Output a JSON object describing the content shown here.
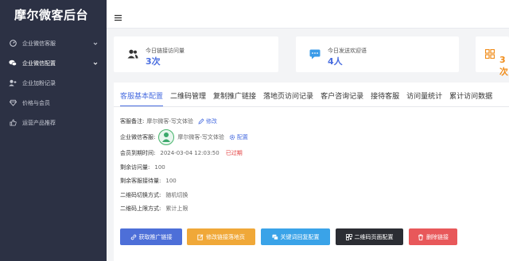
{
  "sidebar": {
    "brand": "摩尔微客后台",
    "items": [
      {
        "label": "企业微信客服",
        "icon": "gauge-icon",
        "chevron": true
      },
      {
        "label": "企业微信配置",
        "icon": "chat-icon",
        "chevron": true
      },
      {
        "label": "企业加粉记录",
        "icon": "add-user-icon",
        "chevron": false
      },
      {
        "label": "价格与会员",
        "icon": "diamond-icon",
        "chevron": false
      },
      {
        "label": "运营产品推荐",
        "icon": "thumbs-up-icon",
        "chevron": false
      }
    ]
  },
  "stats": [
    {
      "label": "今日链接访问量",
      "value": "3次",
      "color": "#4a6ee0",
      "icon": "users-icon"
    },
    {
      "label": "今日发送欢迎语",
      "value": "4人",
      "color": "#4a6ee0",
      "icon": "message-icon"
    },
    {
      "label": "",
      "value": "3次",
      "color": "#f08c1a",
      "icon": "grid-icon"
    }
  ],
  "tabs": [
    "客服基本配置",
    "二维码管理",
    "复制推广链接",
    "落地页访问记录",
    "客户咨询记录",
    "接待客服",
    "访问量统计",
    "累计访问数据"
  ],
  "details": {
    "remark_label": "客服备注:",
    "remark_value": "摩尔微客-写文体验",
    "edit_link": "修改",
    "wechat_label": "企业微信客服:",
    "wechat_value": "摩尔微客-写文体验",
    "config_link": "配置",
    "expiry_label": "会员到期时间:",
    "expiry_value": "2024-03-04 12:03:50",
    "expiry_status": "已过期",
    "visits_left_label": "剩余访问量:",
    "visits_left_value": "100",
    "reception_left_label": "剩余客服接待量:",
    "reception_left_value": "100",
    "switch_label": "二维码切换方式:",
    "switch_value": "随机切换",
    "limit_label": "二维码上限方式:",
    "limit_value": "累计上限"
  },
  "actions": [
    {
      "label": "获取推广链接",
      "color": "#4d6fd8",
      "icon": "link-icon"
    },
    {
      "label": "修改链接落地页",
      "color": "#f0a838",
      "icon": "edit-icon"
    },
    {
      "label": "关键词回复配置",
      "color": "#3aa3e8",
      "icon": "reply-icon"
    },
    {
      "label": "二维码页面配置",
      "color": "#2b2d33",
      "icon": "qrcode-icon"
    },
    {
      "label": "删除链接",
      "color": "#e8585a",
      "icon": "trash-icon"
    }
  ]
}
